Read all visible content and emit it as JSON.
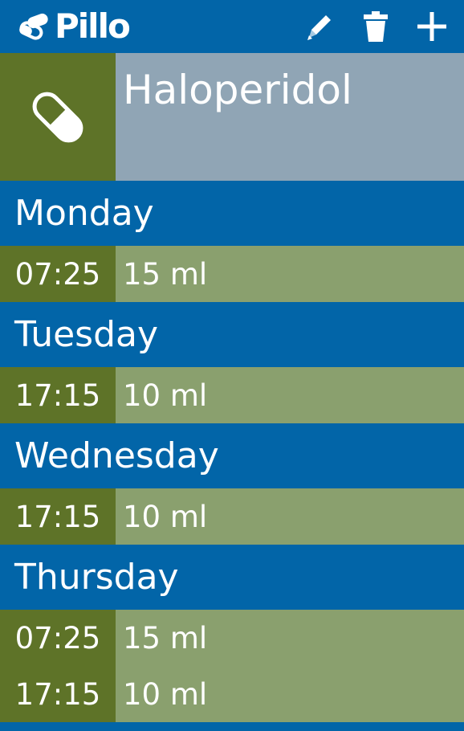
{
  "app": {
    "brand_name": "Pillo"
  },
  "toolbar": {
    "edit_icon": "pencil-icon",
    "delete_icon": "trash-icon",
    "add_icon": "plus-icon"
  },
  "medication": {
    "name": "Haloperidol",
    "icon": "pill-capsule-icon"
  },
  "schedule": [
    {
      "day": "Monday",
      "doses": [
        {
          "time": "07:25",
          "amount": "15 ml"
        }
      ]
    },
    {
      "day": "Tuesday",
      "doses": [
        {
          "time": "17:15",
          "amount": "10 ml"
        }
      ]
    },
    {
      "day": "Wednesday",
      "doses": [
        {
          "time": "17:15",
          "amount": "10 ml"
        }
      ]
    },
    {
      "day": "Thursday",
      "doses": [
        {
          "time": "07:25",
          "amount": "15 ml"
        },
        {
          "time": "17:15",
          "amount": "10 ml"
        }
      ]
    }
  ],
  "colors": {
    "primary_blue": "#0265a8",
    "dark_green": "#5e7328",
    "light_green": "#8aa06e",
    "slate": "#90a5b5"
  }
}
